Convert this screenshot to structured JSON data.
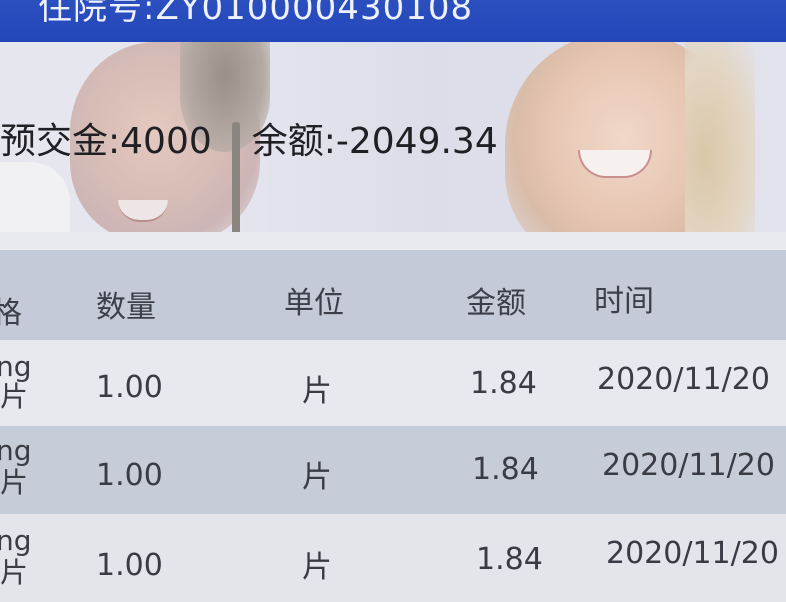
{
  "header": {
    "title": "住院号:ZY010000430108"
  },
  "summary": {
    "deposit": "预交金:4000",
    "balance": "余额:-2049.34"
  },
  "table": {
    "columns": [
      "格",
      "数量",
      "单位",
      "金额",
      "时间"
    ],
    "rows": [
      {
        "spec_top": "ng",
        "spec_bottom": "片",
        "qty": "1.00",
        "unit": "片",
        "amount": "1.84",
        "time": "2020/11/20"
      },
      {
        "spec_top": "ng",
        "spec_bottom": "片",
        "qty": "1.00",
        "unit": "片",
        "amount": "1.84",
        "time": "2020/11/20"
      },
      {
        "spec_top": "ng",
        "spec_bottom": "片",
        "qty": "1.00",
        "unit": "片",
        "amount": "1.84",
        "time": "2020/11/20"
      }
    ]
  },
  "colors": {
    "header_bar": "#2347b8",
    "table_header_bg": "#c4cad7",
    "row_light": "#e8e9ee",
    "row_dark": "#c7ccd9"
  }
}
